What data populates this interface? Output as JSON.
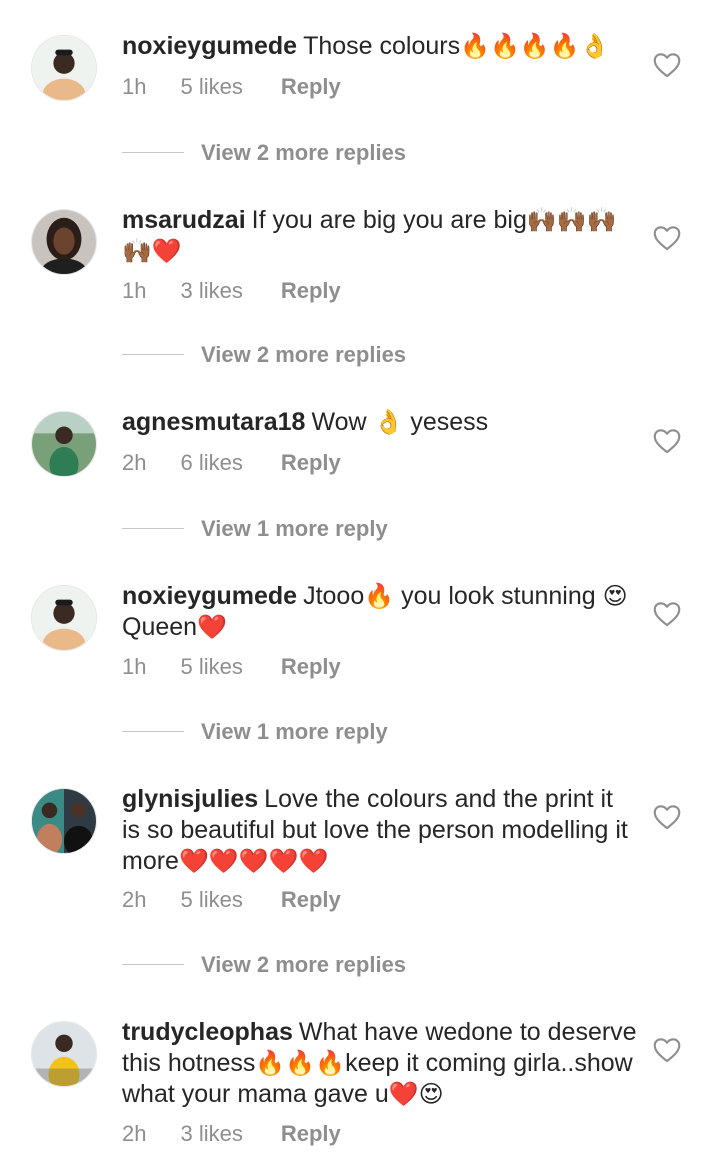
{
  "comments": [
    {
      "username": "noxieygumede",
      "text": "Those colours",
      "emoji": "🔥🔥🔥🔥👌",
      "time": "1h",
      "likes": "5 likes",
      "reply": "Reply",
      "view_more": "View 2 more replies"
    },
    {
      "username": "msarudzai",
      "text": "If you are big you are big",
      "emoji": "🙌🏾🙌🏾🙌🏾🙌🏾❤️",
      "time": "1h",
      "likes": "3 likes",
      "reply": "Reply",
      "view_more": "View 2 more replies"
    },
    {
      "username": "agnesmutara18",
      "text": "Wow",
      "emoji": "👌",
      "text2": "yesess",
      "time": "2h",
      "likes": "6 likes",
      "reply": "Reply",
      "view_more": "View 1 more reply"
    },
    {
      "username": "noxieygumede",
      "text": "Jtooo",
      "emoji": "🔥",
      "text2": "you look stunning",
      "emoji2": "😍",
      "text3": "Queen",
      "emoji3": "❤️",
      "time": "1h",
      "likes": "5 likes",
      "reply": "Reply",
      "view_more": "View 1 more reply"
    },
    {
      "username": "glynisjulies",
      "text": "Love the colours and the print it is so beautiful but love the person modelling it more",
      "emoji": "❤️❤️❤️❤️❤️",
      "time": "2h",
      "likes": "5 likes",
      "reply": "Reply",
      "view_more": "View 2 more replies"
    },
    {
      "username": "trudycleophas",
      "text": "What have wedone to deserve this hotness",
      "emoji": "🔥🔥🔥",
      "text2": "keep it coming girla..show what your mama gave u",
      "emoji2": "❤️😍",
      "time": "2h",
      "likes": "3 likes",
      "reply": "Reply"
    }
  ],
  "icons": {
    "like": "heart-outline-icon",
    "avatar": "profile-avatar"
  },
  "colors": {
    "text": "#262626",
    "secondary": "#8e8e8e",
    "divider": "#c7c7c7"
  }
}
